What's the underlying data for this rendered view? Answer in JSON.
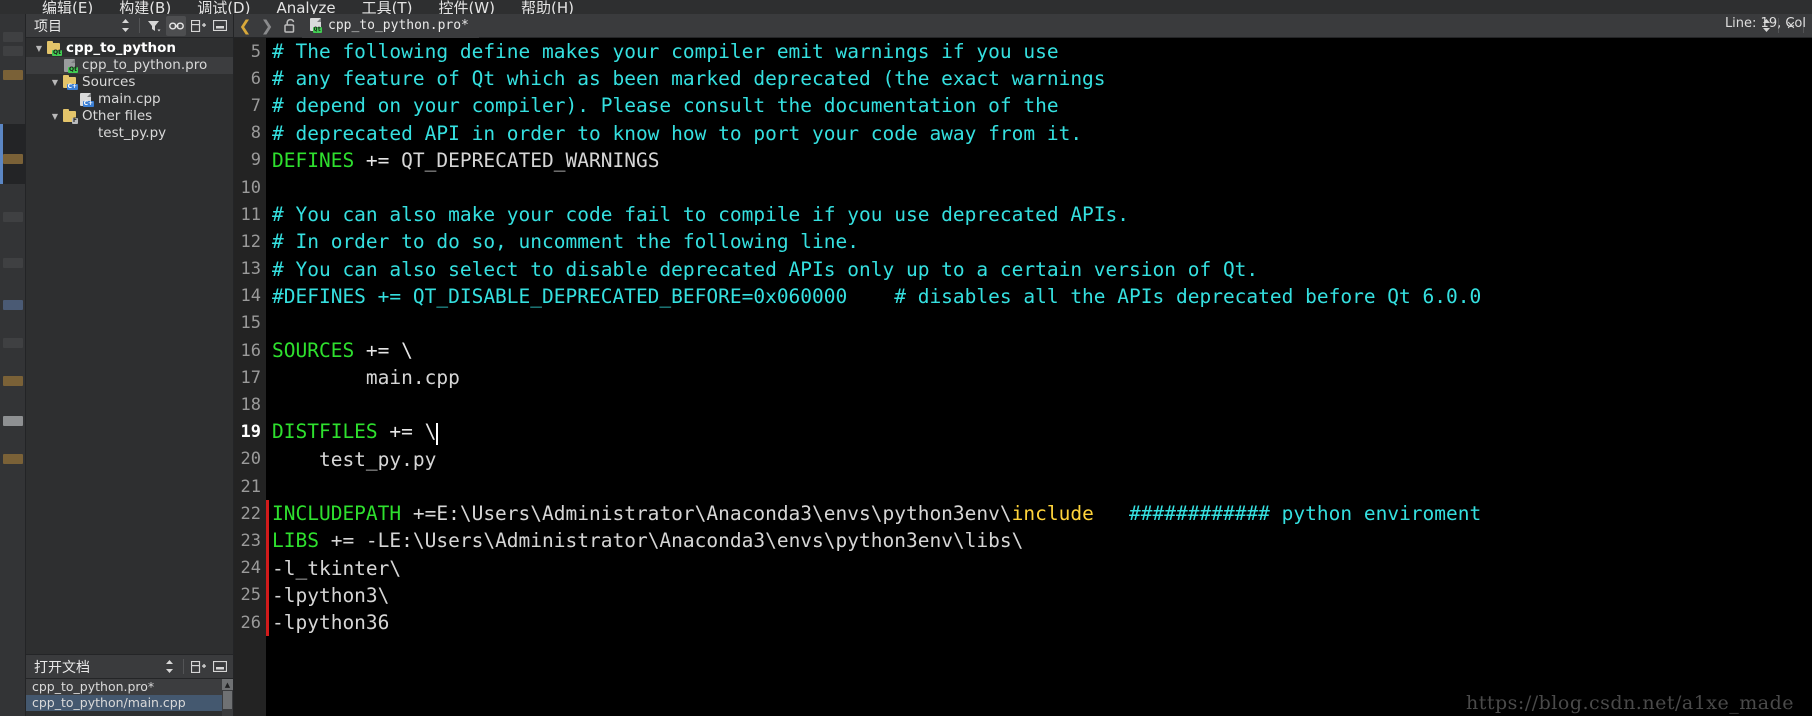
{
  "menubar": {
    "items": [
      {
        "label": "编辑(E)"
      },
      {
        "label": "构建(B)"
      },
      {
        "label": "调试(D)"
      },
      {
        "label": "Analyze"
      },
      {
        "label": "工具(T)"
      },
      {
        "label": "控件(W)"
      },
      {
        "label": "帮助(H)"
      }
    ]
  },
  "sidebar": {
    "title": "项目",
    "tools": [
      "sync-selector",
      "filter",
      "link",
      "expand",
      "collapse"
    ],
    "tree": [
      {
        "label": "cpp_to_python",
        "indent": 0,
        "icon": "qt-project-folder",
        "arrow": "down",
        "bold": true,
        "selected": false
      },
      {
        "label": "cpp_to_python.pro",
        "indent": 1,
        "icon": "qt-pro-file",
        "arrow": "",
        "bold": false,
        "selected": true
      },
      {
        "label": "Sources",
        "indent": 1,
        "icon": "cpp-folder",
        "arrow": "down",
        "bold": false,
        "selected": false
      },
      {
        "label": "main.cpp",
        "indent": 2,
        "icon": "cpp-file",
        "arrow": "",
        "bold": false,
        "selected": false
      },
      {
        "label": "Other files",
        "indent": 1,
        "icon": "other-folder",
        "arrow": "down",
        "bold": false,
        "selected": false
      },
      {
        "label": "test_py.py",
        "indent": 2,
        "icon": "",
        "arrow": "",
        "bold": false,
        "selected": false
      }
    ]
  },
  "opendocs": {
    "title": "打开文档",
    "items": [
      {
        "label": "cpp_to_python.pro*",
        "state": "current"
      },
      {
        "label": "cpp_to_python/main.cpp",
        "state": "selected"
      }
    ]
  },
  "tabbar": {
    "back_label": "❮",
    "forward_label": "❯",
    "lock_label": "unlocked",
    "tab_label": "cpp_to_python.pro*",
    "dropdown_label": "⬍",
    "close_label": "✕"
  },
  "status": {
    "cursor": "Line: 19, Col"
  },
  "editor": {
    "current_line": 19,
    "lines": [
      {
        "n": 5,
        "spans": [
          {
            "t": "# The following define makes your compiler emit warnings if you use",
            "c": "cm"
          }
        ]
      },
      {
        "n": 6,
        "spans": [
          {
            "t": "# any feature of Qt which as been marked deprecated (the exact warnings",
            "c": "cm"
          }
        ]
      },
      {
        "n": 7,
        "spans": [
          {
            "t": "# depend on your compiler). Please consult the documentation of the",
            "c": "cm"
          }
        ]
      },
      {
        "n": 8,
        "spans": [
          {
            "t": "# deprecated API in order to know how to port your code away from it.",
            "c": "cm"
          }
        ]
      },
      {
        "n": 9,
        "spans": [
          {
            "t": "DEFINES",
            "c": "kw"
          },
          {
            "t": " += ",
            "c": "op"
          },
          {
            "t": "QT_DEPRECATED_WARNINGS",
            "c": "val"
          }
        ]
      },
      {
        "n": 10,
        "spans": []
      },
      {
        "n": 11,
        "spans": [
          {
            "t": "# You can also make your code fail to compile if you use deprecated APIs.",
            "c": "cm"
          }
        ]
      },
      {
        "n": 12,
        "spans": [
          {
            "t": "# In order to do so, uncomment the following line.",
            "c": "cm"
          }
        ]
      },
      {
        "n": 13,
        "spans": [
          {
            "t": "# You can also select to disable deprecated APIs only up to a certain version of Qt.",
            "c": "cm"
          }
        ]
      },
      {
        "n": 14,
        "spans": [
          {
            "t": "#DEFINES += QT_DISABLE_DEPRECATED_BEFORE=0x060000    # disables all the APIs deprecated before Qt 6.0.0",
            "c": "cm"
          }
        ]
      },
      {
        "n": 15,
        "spans": []
      },
      {
        "n": 16,
        "spans": [
          {
            "t": "SOURCES",
            "c": "kw"
          },
          {
            "t": " += \\",
            "c": "op"
          }
        ]
      },
      {
        "n": 17,
        "spans": [
          {
            "t": "        main.cpp",
            "c": "val"
          }
        ]
      },
      {
        "n": 18,
        "spans": []
      },
      {
        "n": 19,
        "spans": [
          {
            "t": "DISTFILES",
            "c": "kw"
          },
          {
            "t": " += \\",
            "c": "op"
          }
        ],
        "caret": true
      },
      {
        "n": 20,
        "spans": [
          {
            "t": "    test_py.py",
            "c": "val"
          }
        ]
      },
      {
        "n": 21,
        "spans": []
      },
      {
        "n": 22,
        "spans": [
          {
            "t": "INCLUDEPATH",
            "c": "kw"
          },
          {
            "t": " +=E:\\Users\\Administrator\\Anaconda3\\envs\\python3env\\",
            "c": "val"
          },
          {
            "t": "include",
            "c": "hl"
          },
          {
            "t": "   ",
            "c": "val"
          },
          {
            "t": "############ python enviroment",
            "c": "cm"
          }
        ],
        "redmark": true
      },
      {
        "n": 23,
        "spans": [
          {
            "t": "LIBS",
            "c": "kw"
          },
          {
            "t": " += -LE:\\Users\\Administrator\\Anaconda3\\envs\\python3env\\libs\\",
            "c": "val"
          }
        ],
        "redmark": true
      },
      {
        "n": 24,
        "spans": [
          {
            "t": "-l_tkinter\\",
            "c": "val"
          }
        ],
        "redmark": true
      },
      {
        "n": 25,
        "spans": [
          {
            "t": "-lpython3\\",
            "c": "val"
          }
        ],
        "redmark": true
      },
      {
        "n": 26,
        "spans": [
          {
            "t": "-lpython36",
            "c": "val"
          }
        ],
        "redmark": true
      }
    ]
  },
  "watermark": {
    "text": "https://blog.csdn.net/a1xe_made"
  },
  "colors": {
    "comment": "#35e0e0",
    "keyword": "#2ee02e",
    "highlight": "#ffd43b",
    "editor_bg": "#000000",
    "chrome_bg": "#2e2f30",
    "panel_bg": "#3a3b3d",
    "error_mark": "#d11b1b"
  }
}
